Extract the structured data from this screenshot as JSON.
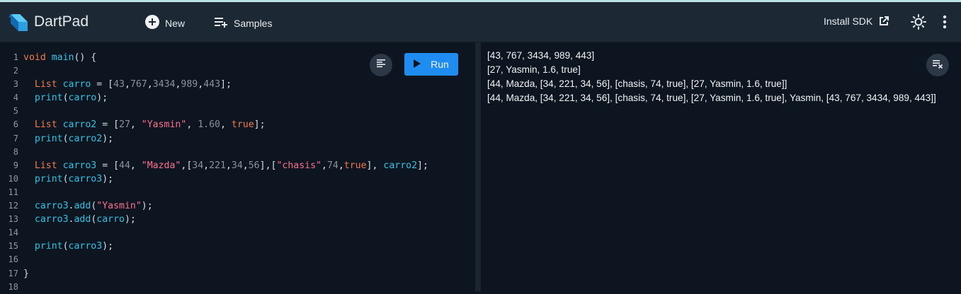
{
  "header": {
    "app_title": "DartPad",
    "new_label": "New",
    "samples_label": "Samples",
    "install_sdk_label": "Install SDK"
  },
  "editor": {
    "run_label": "Run",
    "line_numbers": [
      "1",
      "2",
      "3",
      "4",
      "5",
      "6",
      "7",
      "8",
      "9",
      "10",
      "11",
      "12",
      "13",
      "14",
      "15",
      "16",
      "17",
      "18"
    ],
    "code": {
      "l1_kw": "void",
      "l1_fn": "main",
      "l1_rest": "() {",
      "l3_ty": "List",
      "l3_var": "carro",
      "l3_eq": " = [",
      "l3_n1": "43",
      "l3_n2": "767",
      "l3_n3": "3434",
      "l3_n4": "989",
      "l3_n5": "443",
      "l3_end": "];",
      "l4_print": "print",
      "l4_var": "carro",
      "l4_end": ");",
      "l6_ty": "List",
      "l6_var": "carro2",
      "l6_eq": " = [",
      "l6_n1": "27",
      "l6_s1": "\"Yasmin\"",
      "l6_n2": "1.60",
      "l6_b1": "true",
      "l6_end": "];",
      "l7_print": "print",
      "l7_var": "carro2",
      "l7_end": ");",
      "l9_ty": "List",
      "l9_var": "carro3",
      "l9_eq": " = [",
      "l9_n1": "44",
      "l9_s1": "\"Mazda\"",
      "l9_n2": "34",
      "l9_n3": "221",
      "l9_n4": "34",
      "l9_n5": "56",
      "l9_s2": "\"chasis\"",
      "l9_n6": "74",
      "l9_b1": "true",
      "l9_v2": "carro2",
      "l9_end": "];",
      "l10_print": "print",
      "l10_var": "carro3",
      "l10_end": ");",
      "l12_var": "carro3",
      "l12_add": "add",
      "l12_s1": "\"Yasmin\"",
      "l12_end": ");",
      "l13_var": "carro3",
      "l13_add": "add",
      "l13_arg": "carro",
      "l13_end": ");",
      "l15_print": "print",
      "l15_var": "carro3",
      "l15_end": ");",
      "l17": "}"
    }
  },
  "console": {
    "output": [
      "[43, 767, 3434, 989, 443]",
      "[27, Yasmin, 1.6, true]",
      "[44, Mazda, [34, 221, 34, 56], [chasis, 74, true], [27, Yasmin, 1.6, true]]",
      "[44, Mazda, [34, 221, 34, 56], [chasis, 74, true], [27, Yasmin, 1.6, true], Yasmin, [43, 767, 3434, 989, 443]]"
    ]
  },
  "icons": {
    "logo": "dart-logo-icon",
    "new": "plus-circle-icon",
    "samples": "playlist-add-icon",
    "install_sdk": "open-external-icon",
    "theme": "sun-icon",
    "more": "more-vert-icon",
    "format": "format-align-icon",
    "run": "play-icon",
    "clear": "clear-all-icon"
  },
  "colors": {
    "run_button": "#1f8cf2",
    "header_bg": "#1c2834",
    "editor_bg": "#0d1520",
    "keyword": "#f07b4b",
    "identifier": "#2ec4e6",
    "string": "#ff6f8d"
  }
}
